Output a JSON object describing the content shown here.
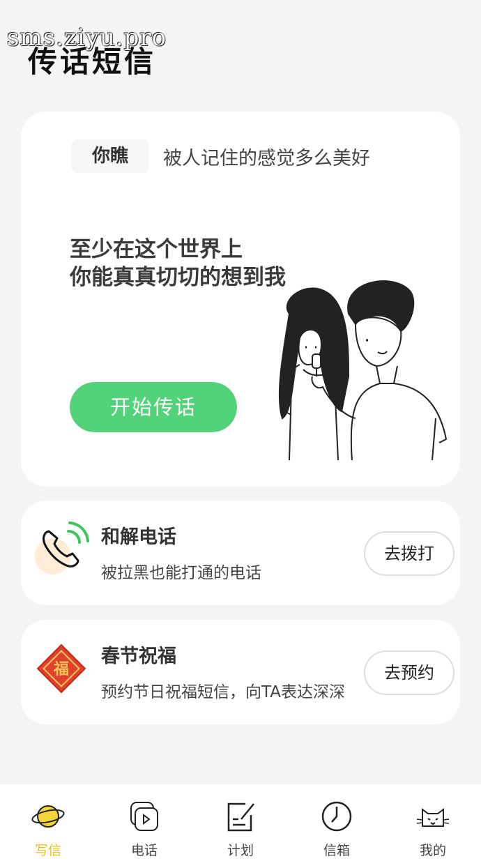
{
  "watermark": "sms.ziyu.pro",
  "title": "传话短信",
  "hero": {
    "tag": "你瞧",
    "tag_text": "被人记住的感觉多么美好",
    "headline_line1": "至少在这个世界上",
    "headline_line2": "你能真真切切的想到我",
    "button": "开始传话"
  },
  "cards": [
    {
      "title": "和解电话",
      "subtitle": "被拉黑也能打通的电话",
      "button": "去拨打",
      "icon": "phone-icon"
    },
    {
      "title": "春节祝福",
      "subtitle": "预约节日祝福短信，向TA表达深深",
      "button": "去预约",
      "icon": "fu-icon"
    }
  ],
  "tabs": [
    {
      "label": "写信",
      "icon": "planet-icon",
      "active": true
    },
    {
      "label": "电话",
      "icon": "video-icon",
      "active": false
    },
    {
      "label": "计划",
      "icon": "edit-icon",
      "active": false
    },
    {
      "label": "信箱",
      "icon": "clock-icon",
      "active": false
    },
    {
      "label": "我的",
      "icon": "cat-icon",
      "active": false
    }
  ],
  "colors": {
    "accent_green": "#52d37a",
    "active_tab": "#e6c230",
    "background": "#f4f4f4"
  }
}
